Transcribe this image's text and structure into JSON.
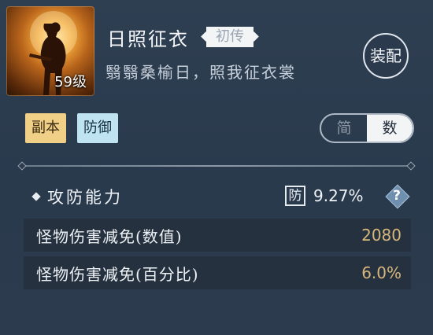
{
  "header": {
    "level_label": "59级",
    "title": "日照征衣",
    "rarity": "初传",
    "subtitle": "翳翳桑榆日，照我征衣裳",
    "equip_label": "装配"
  },
  "tags": [
    {
      "label": "副本",
      "color": "#f0cf86"
    },
    {
      "label": "防御",
      "color": "#bfe3f0"
    }
  ],
  "toggle": {
    "options": [
      "简",
      "数"
    ],
    "selected": "数"
  },
  "section": {
    "title": "攻防能力",
    "badge": "防",
    "value": "9.27%"
  },
  "stats": [
    {
      "label": "怪物伤害减免(数值)",
      "value": "2080"
    },
    {
      "label": "怪物伤害减免(百分比)",
      "value": "6.0%"
    }
  ],
  "colors": {
    "background": "#2b3a4c",
    "stat_value": "#d8b87a",
    "tag_yellow": "#f0cf86",
    "tag_blue": "#bfe3f0"
  }
}
